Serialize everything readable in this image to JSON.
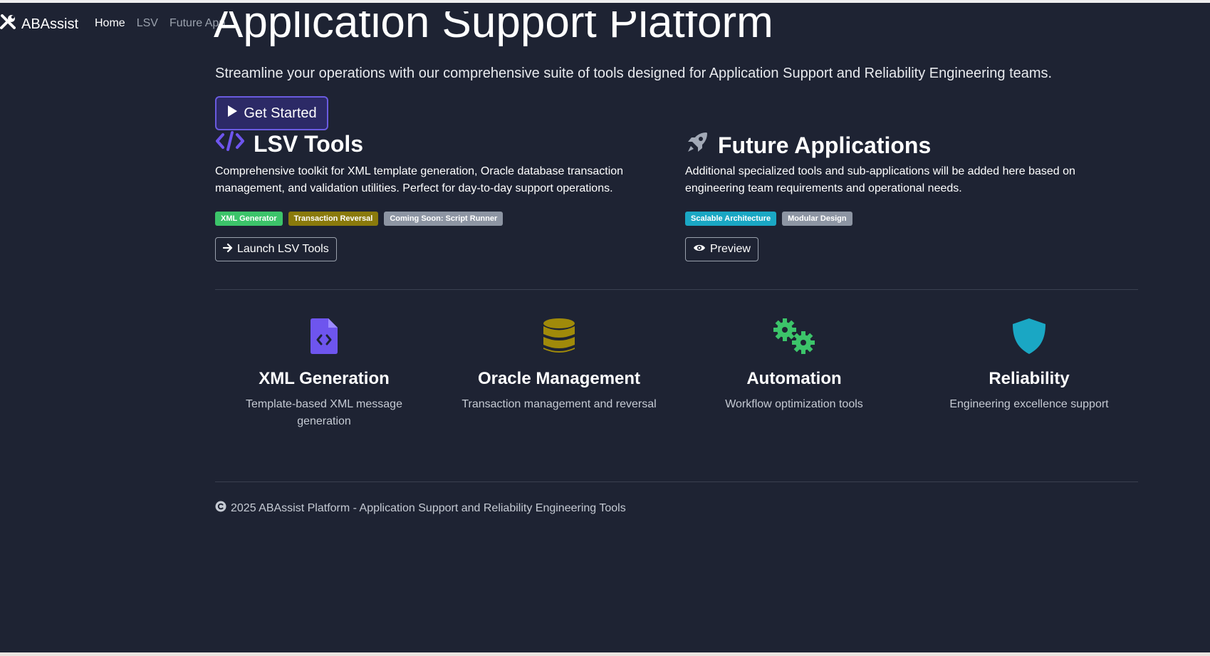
{
  "navbar": {
    "brand": "ABAssist",
    "brand_icon": "tools-icon",
    "links": [
      {
        "label": "Home",
        "active": true
      },
      {
        "label": "LSV",
        "active": false
      },
      {
        "label": "Future App",
        "active": false
      }
    ]
  },
  "hero": {
    "title": "Application Support Platform",
    "subtitle": "Streamline your operations with our comprehensive suite of tools designed for Application Support and Reliability Engineering teams.",
    "cta_label": "Get Started",
    "cta_icon": "play-icon"
  },
  "sections": {
    "lsv": {
      "title": "LSV Tools",
      "icon": "code-icon",
      "description": "Comprehensive toolkit for XML template generation, Oracle database transaction management, and validation utilities. Perfect for day-to-day support operations.",
      "badges": [
        {
          "label": "XML Generator",
          "color": "#3cc46a"
        },
        {
          "label": "Transaction Reversal",
          "color": "#8a7a0c"
        },
        {
          "label": "Coming Soon: Script Runner",
          "color": "#8d95a3"
        }
      ],
      "button_label": "Launch LSV Tools",
      "button_icon": "arrow-right-icon"
    },
    "future": {
      "title": "Future Applications",
      "icon": "rocket-icon",
      "description": "Additional specialized tools and sub-applications will be added here based on engineering team requirements and operational needs.",
      "badges": [
        {
          "label": "Scalable Architecture",
          "color": "#1aa7c4"
        },
        {
          "label": "Modular Design",
          "color": "#8d95a3"
        }
      ],
      "button_label": "Preview",
      "button_icon": "eye-icon"
    }
  },
  "features": [
    {
      "title": "XML Generation",
      "description": "Template-based XML message generation",
      "icon": "file-code-icon",
      "color": "#6e55ee"
    },
    {
      "title": "Oracle Management",
      "description": "Transaction management and reversal",
      "icon": "database-icon",
      "color": "#a08a0a"
    },
    {
      "title": "Automation",
      "description": "Workflow optimization tools",
      "icon": "gears-icon",
      "color": "#3cc46a"
    },
    {
      "title": "Reliability",
      "description": "Engineering excellence support",
      "icon": "shield-icon",
      "color": "#1aa7c4"
    }
  ],
  "footer": {
    "text": "2025 ABAssist Platform - Application Support and Reliability Engineering Tools",
    "icon": "copyright-icon"
  },
  "colors": {
    "background": "#1e2333",
    "accent": "#6a5be0"
  }
}
